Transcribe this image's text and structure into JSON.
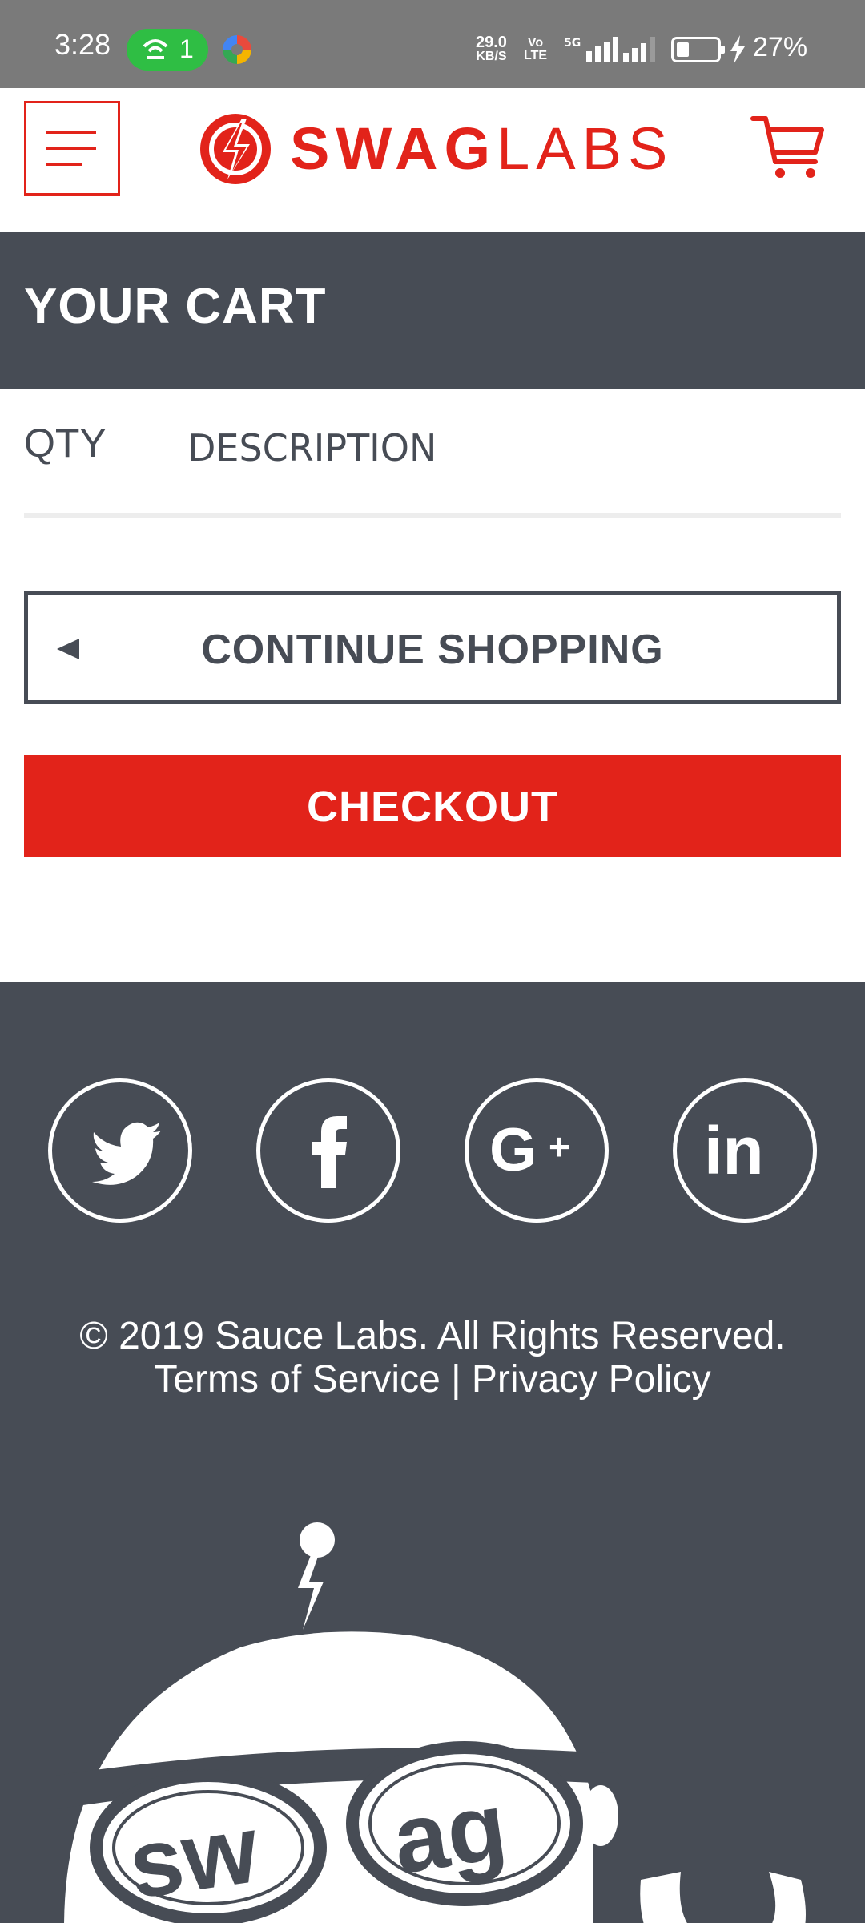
{
  "status_bar": {
    "time": "3:28",
    "hotspot_count": "1",
    "net_speed_value": "29.0",
    "net_speed_unit": "KB/S",
    "volte_top": "Vo",
    "volte_bottom": "LTE",
    "network": "5G",
    "battery_percent": "27%"
  },
  "header": {
    "menu_icon": "hamburger-menu-icon",
    "logo_bold": "SWAG",
    "logo_light": "LABS",
    "cart_icon": "shopping-cart-icon",
    "brand_color": "#e2231a"
  },
  "page": {
    "title": "YOUR CART"
  },
  "cart": {
    "qty_header": "QTY",
    "description_header": "DESCRIPTION",
    "items": []
  },
  "actions": {
    "continue_shopping": "CONTINUE SHOPPING",
    "checkout": "CHECKOUT"
  },
  "footer": {
    "social": [
      "twitter-icon",
      "facebook-icon",
      "google-plus-icon",
      "linkedin-icon"
    ],
    "copyright": "© 2019 Sauce Labs. All Rights Reserved.",
    "links": "Terms of Service | Privacy Policy",
    "mascot_text_left": "sw",
    "mascot_text_right": "ag",
    "background": "#474c55"
  }
}
